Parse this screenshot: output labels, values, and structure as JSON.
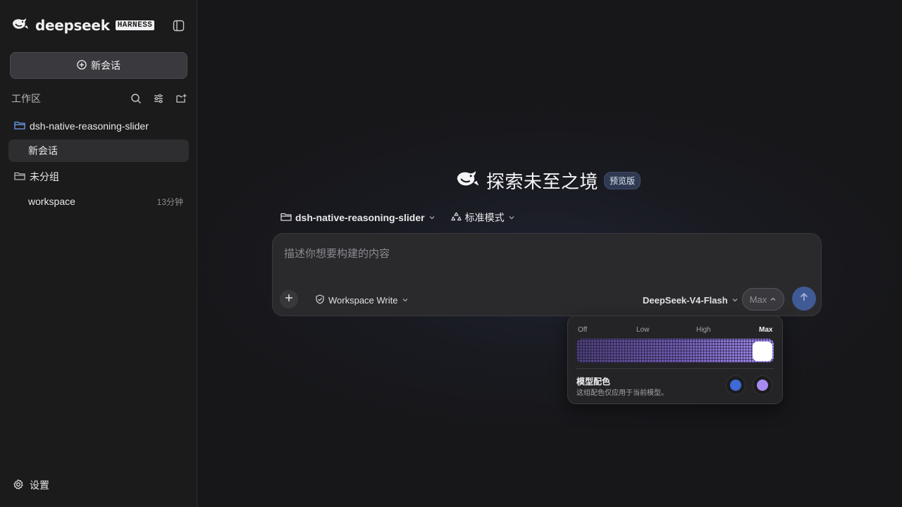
{
  "app": {
    "brand_name": "deepseek",
    "brand_tag": "HARNESS"
  },
  "sidebar": {
    "new_chat_label": "新会话",
    "workspace_title": "工作区",
    "project_folder": "dsh-native-reasoning-slider",
    "project_session": "新会话",
    "ungrouped_folder": "未分组",
    "ungrouped_item": {
      "label": "workspace",
      "time": "13分钟"
    },
    "settings_label": "设置"
  },
  "main": {
    "hero_title": "探索未至之境",
    "hero_badge": "预览版",
    "project_selector": "dsh-native-reasoning-slider",
    "mode_selector": "标准模式",
    "composer_placeholder": "描述你想要构建的内容",
    "permission_label": "Workspace Write",
    "model_label": "DeepSeek-V4-Flash",
    "effort_label": "Max"
  },
  "reasoning_popover": {
    "levels": [
      "Off",
      "Low",
      "High",
      "Max"
    ],
    "selected_level": "Max",
    "slider_value_fraction": 1.0,
    "color_title": "模型配色",
    "color_desc": "这组配色仅应用于当前模型。",
    "swatch_colors": [
      "#3d6ad6",
      "#a88bf0"
    ]
  },
  "colors": {
    "accent_send": "#3f5a95",
    "slider_gradient": [
      "#4c3f78",
      "#a38cf0"
    ]
  }
}
